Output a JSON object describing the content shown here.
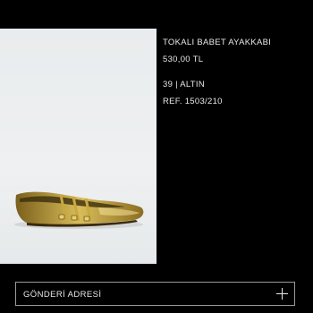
{
  "product": {
    "name": "TOKALI BABET AYAKKABI",
    "price": "530,00 TL",
    "variant": "39 | ALTIN",
    "reference": "REF. 1503/210",
    "image_alt": "gold-metallic-strapped-ballet-flat"
  },
  "shipping": {
    "address_label": "GÖNDERİ ADRESİ",
    "expand_icon": "plus-icon"
  },
  "colors": {
    "background": "#000000",
    "text": "#e8e8e8",
    "border": "#9a9a9a",
    "shoe_gold": "#c9a93f"
  }
}
